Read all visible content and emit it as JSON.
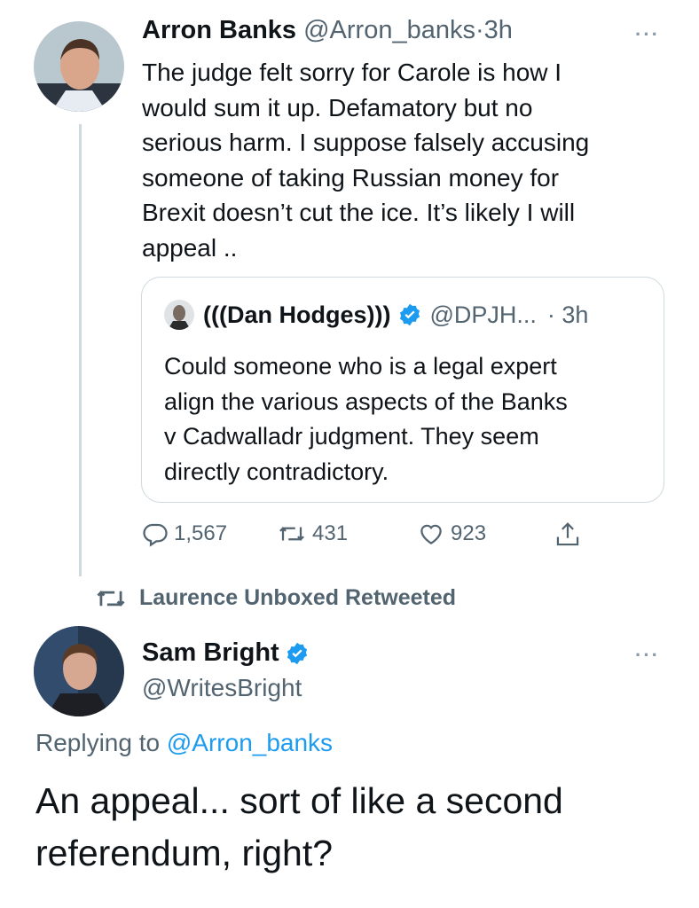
{
  "tweet1": {
    "author_name": "Arron Banks",
    "author_handle": "@Arron_banks",
    "separator": "·",
    "time": "3h",
    "more_label": "···",
    "text": "The judge felt sorry for Carole is how I\nwould sum it up. Defamatory but no\nserious harm. I suppose falsely accusing\nsomeone of taking Russian money for\nBrexit doesn’t cut the ice. It’s likely I will\nappeal ..",
    "quote": {
      "author_name": "(((Dan Hodges)))",
      "author_handle": "@DPJH...",
      "time": "· 3h",
      "text": "Could someone who is a legal expert\nalign the various aspects of the Banks\nv Cadwalladr judgment. They seem\ndirectly contradictory."
    },
    "actions": {
      "replies": "1,567",
      "retweets": "431",
      "likes": "923"
    }
  },
  "retweeted_by": "Laurence Unboxed Retweeted",
  "tweet2": {
    "author_name": "Sam Bright",
    "author_handle": "@WritesBright",
    "more_label": "···",
    "replying_prefix": "Replying to",
    "replying_to": "@Arron_banks",
    "text": "An appeal... sort of like a second\nreferendum, right?"
  },
  "colors": {
    "accent": "#1d9bf0",
    "muted": "#536471",
    "border": "#cfd9de"
  },
  "icons": [
    "reply-icon",
    "retweet-icon",
    "like-icon",
    "share-icon",
    "verified-badge-icon",
    "more-icon"
  ]
}
